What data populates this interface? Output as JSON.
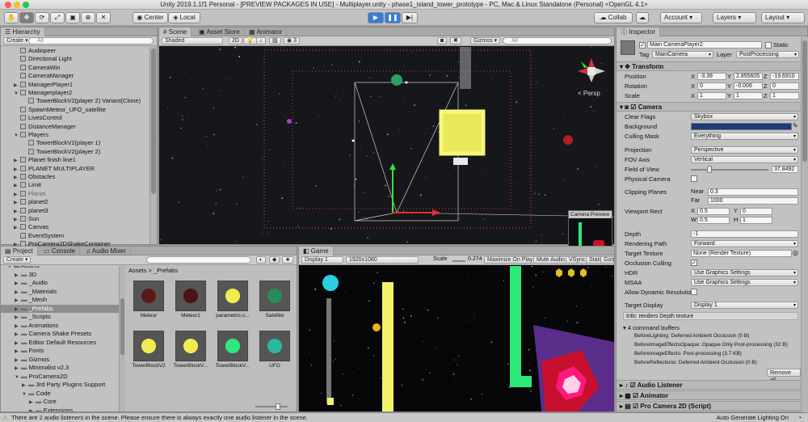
{
  "window": {
    "title": "Unity 2019.1.1f1 Personal - [PREVIEW PACKAGES IN USE] - Multiplayer.unity - phase1_island_tower_prototype - PC, Mac & Linux Standalone (Personal) <OpenGL 4.1>"
  },
  "toolbar": {
    "center": "Center",
    "local": "Local",
    "collab": "Collab",
    "account": "Account",
    "layers": "Layers",
    "layout": "Layout"
  },
  "hierarchy": {
    "tab": "Hierarchy",
    "create": "Create",
    "search": "All",
    "items": [
      "Audiopeer",
      "Directional Light",
      "CameraWin",
      "CameraManager",
      "ManagerPlayer1",
      "Managerplayer2",
      "TowerBlockV2(player 2)  Variant(Clone)",
      "SpawnMeteor_UFO_satellite",
      "LivesControl",
      "DistanceManager",
      "Players",
      "TowerBlockV2(player 1)",
      "TowerBlockV2(player 2)",
      "Planet finish line1",
      "PLANET MULTIPLAYER",
      "Obstacles",
      "Limit",
      "Planet",
      "planet2",
      "planet3",
      "Sun",
      "Canvas",
      "EventSystem",
      "ProCamera2DShakeContainer"
    ]
  },
  "scene": {
    "tabs": [
      "Scene",
      "Asset Store",
      "Animator"
    ],
    "shading": "Shaded",
    "mode2d": "2D",
    "layers_count": "3",
    "gizmos": "Gizmos",
    "search": "All",
    "persp": "< Persp",
    "preview_title": "Camera Preview"
  },
  "project": {
    "tabs": [
      "Project",
      "Console",
      "Audio Mixer"
    ],
    "create": "Create",
    "tree": [
      "Assets",
      "3D",
      "_Audio",
      "_Materials",
      "_Mesh",
      "_Prefabs",
      "_Scripts",
      "Animations",
      "Camera Shake Presets",
      "Editor Default Resources",
      "Fonts",
      "Gizmos",
      "Minimalist v2.3",
      "ProCamera2D",
      "3rd Party Plugins Support",
      "Code",
      "Core",
      "Extensions"
    ],
    "breadcrumb": "Assets > _Prefabs",
    "assets": [
      "Meteor",
      "Meteor1",
      "parametric-c...",
      "Satellite",
      "TowerBlockV2",
      "TowerBlockV...",
      "TowerBlockV...",
      "UFO"
    ]
  },
  "game": {
    "tab": "Game",
    "display": "Display 1",
    "resolution": "1920x1080",
    "scale_label": "Scale",
    "scale_value": "0.274",
    "maximize": "Maximize On Play",
    "mute": "Mute Audio",
    "vsync": "VSync",
    "stats": "Stats",
    "gizmos": "Gizmos"
  },
  "inspector": {
    "tab": "Inspector",
    "object_name": "Main CameraPlayer2",
    "static": "Static",
    "tag_label": "Tag",
    "tag": "MainCamera",
    "layer_label": "Layer",
    "layer": "PostProcessing",
    "transform": {
      "title": "Transform",
      "rows": [
        {
          "label": "Position",
          "x": "-3.39",
          "y": "2.855605",
          "z": "-19.6910"
        },
        {
          "label": "Rotation",
          "x": "0",
          "y": "-0.006",
          "z": "0"
        },
        {
          "label": "Scale",
          "x": "1",
          "y": "1",
          "z": "1"
        }
      ]
    },
    "camera": {
      "title": "Camera",
      "clear_flags_label": "Clear Flags",
      "clear_flags": "Skybox",
      "background_label": "Background",
      "culling_label": "Culling Mask",
      "culling": "Everything",
      "projection_label": "Projection",
      "projection": "Perspective",
      "fov_axis_label": "FOV Axis",
      "fov_axis": "Vertical",
      "fov_label": "Field of View",
      "fov": "37.8492",
      "physical_label": "Physical Camera",
      "clipping_label": "Clipping Planes",
      "near_label": "Near",
      "near": "0.3",
      "far_label": "Far",
      "far": "1000",
      "viewport_label": "Viewport Rect",
      "vx": "0.5",
      "vy": "0",
      "vw": "0.5",
      "vh": "1",
      "depth_label": "Depth",
      "depth": "-1",
      "render_path_label": "Rendering Path",
      "render_path": "Forward",
      "target_label": "Target Texture",
      "target": "None (Render Texture)",
      "occlusion_label": "Occlusion Culling",
      "hdr_label": "HDR",
      "hdr": "Use Graphics Settings",
      "msaa_label": "MSAA",
      "msaa": "Use Graphics Settings",
      "dyn_label": "Allow Dynamic Resolutio",
      "target_display_label": "Target Display",
      "target_display": "Display 1",
      "info": "Info: renders Depth texture",
      "buffers_title": "4 command buffers",
      "buffers": [
        "BeforeLighting: Deferred Ambient Occlusion (0 B)",
        "BeforeImageEffectsOpaque: Opaque Only Post-processing (32 B)",
        "BeforeImageEffects: Post-processing (3.7 KB)",
        "BeforeReflections: Deferred Ambient Occlusion (0 B)"
      ],
      "remove_all": "Remove all"
    },
    "components": [
      "Audio Listener",
      "Animator",
      "Pro Camera 2D (Script)"
    ]
  },
  "status": {
    "message": "There are 2 audio listeners in the scene. Please ensure there is always exactly one audio listener in the scene.",
    "right": "Auto Generate Lighting On"
  },
  "colors": {
    "camera_background": "#1e3a78",
    "accent_blue": "#3b7bd8",
    "neon_yellow": "#f3f36a",
    "neon_green": "#2ee87a",
    "red_tower": "#c8102e"
  }
}
